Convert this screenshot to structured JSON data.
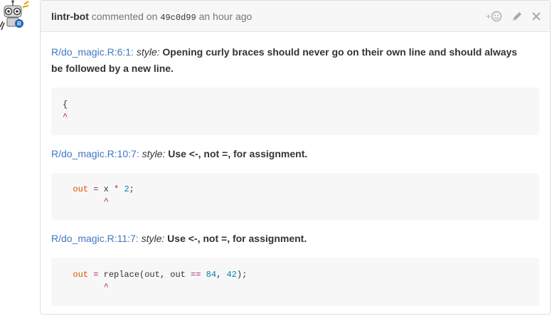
{
  "comment": {
    "author": "lintr-bot",
    "action_text": "commented on",
    "commit_sha": "49c0d99",
    "time_ago": "an hour ago",
    "actions": {
      "add_reaction_icon": "smiley-plus-icon",
      "edit_icon": "pencil-icon",
      "delete_icon": "close-icon"
    }
  },
  "lints": [
    {
      "location": "R/do_magic.R:6:1:",
      "type": "style:",
      "message_line1": "Opening curly braces should never go on their own line and should always",
      "message_line2": "be followed by a new line.",
      "code": {
        "line": "{",
        "caret": "^"
      }
    },
    {
      "location": "R/do_magic.R:10:7:",
      "type": "style:",
      "message": "Use <-, not =, for assignment.",
      "code": {
        "indent": "  ",
        "var": "out",
        "op": "=",
        "rest_a": " x ",
        "op2": "*",
        "rest_b": " ",
        "num": "2",
        "rest_c": ";",
        "caret": "^"
      }
    },
    {
      "location": "R/do_magic.R:11:7:",
      "type": "style:",
      "message": "Use <-, not =, for assignment.",
      "code": {
        "indent": "  ",
        "var": "out",
        "op": "=",
        "rest_a": " replace(out, out ",
        "op2": "==",
        "rest_b": " ",
        "num": "84",
        "rest_c": ", ",
        "num2": "42",
        "rest_d": ");",
        "caret": "^"
      }
    }
  ],
  "colors": {
    "link": "#4078c0",
    "code_bg": "#f7f7f7",
    "operator": "#a71d5d",
    "number": "#0086b3",
    "variable": "#df5000"
  }
}
